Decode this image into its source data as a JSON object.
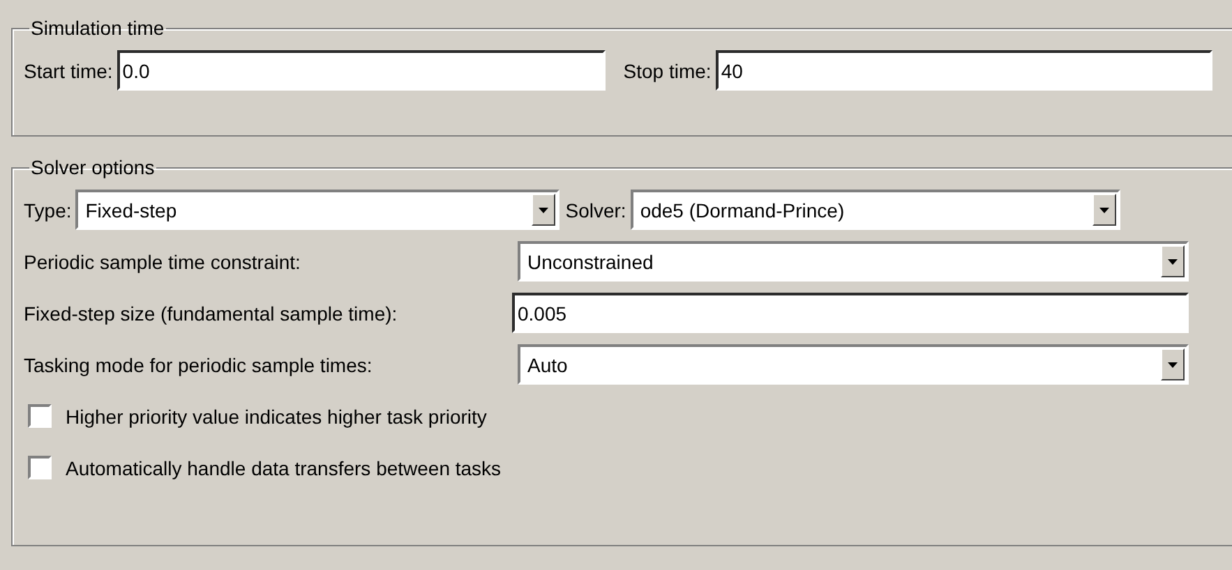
{
  "simulation_time": {
    "title": "Simulation time",
    "start_time": {
      "label": "Start time:",
      "value": "0.0"
    },
    "stop_time": {
      "label": "Stop time:",
      "value": "40"
    }
  },
  "solver_options": {
    "title": "Solver options",
    "type": {
      "label": "Type:",
      "value": "Fixed-step"
    },
    "solver": {
      "label": "Solver:",
      "value": "ode5 (Dormand-Prince)"
    },
    "rows": [
      {
        "kind": "dropdown",
        "label": "Periodic sample time constraint:",
        "value": "Unconstrained"
      },
      {
        "kind": "input",
        "label": "Fixed-step size (fundamental sample time):",
        "value": "0.005"
      },
      {
        "kind": "dropdown",
        "label": "Tasking mode for periodic sample times:",
        "value": "Auto"
      }
    ],
    "checkboxes": [
      {
        "label": "Higher priority value indicates higher task priority",
        "checked": false
      },
      {
        "label": "Automatically handle data transfers between tasks",
        "checked": false
      }
    ]
  }
}
